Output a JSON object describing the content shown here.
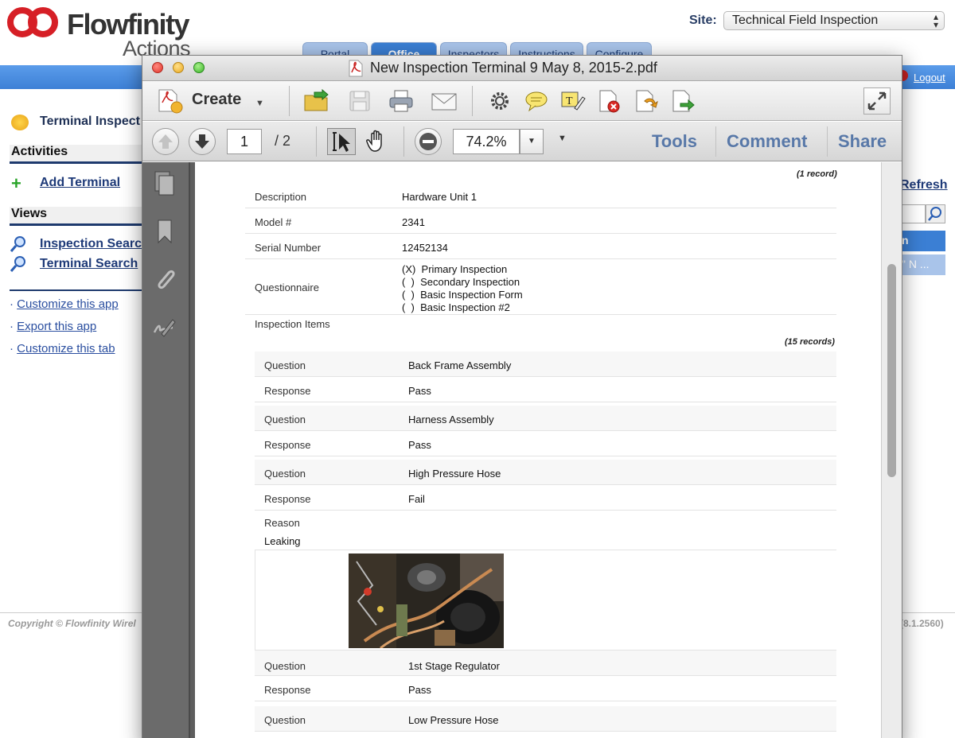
{
  "app": {
    "logo_word": "Flowfinity",
    "logo_sub": "Actions",
    "site_label": "Site:",
    "site_value": "Technical Field Inspection",
    "tabs": [
      {
        "label": "Portal"
      },
      {
        "label": "Office"
      },
      {
        "label": "Inspectors"
      },
      {
        "label": "Instructions"
      },
      {
        "label": "Configure"
      }
    ],
    "logout": "Logout",
    "page_title": "Terminal Inspect",
    "activities_head": "Activities",
    "add_terminal": "Add Terminal",
    "views_head": "Views",
    "inspection_search": "Inspection Searc",
    "terminal_search": "Terminal Search",
    "links": [
      "Customize this app",
      "Export this app",
      "Customize this tab"
    ],
    "copyright": "Copyright © Flowfinity Wirel",
    "version": "(8.1.2560)",
    "refresh": "Refresh",
    "right_blue": "n",
    "right_row": "\" N ..."
  },
  "pdf": {
    "window_title": "New Inspection Terminal 9 May 8, 2015-2.pdf",
    "create_label": "Create",
    "page_current": "1",
    "page_total": "/ 2",
    "zoom": "74.2%",
    "panels": [
      "Tools",
      "Comment",
      "Share"
    ],
    "content": {
      "record_note": "(1 record)",
      "fields": [
        {
          "label": "Description",
          "value": "Hardware Unit 1"
        },
        {
          "label": "Model #",
          "value": "2341"
        },
        {
          "label": "Serial Number",
          "value": "12452134"
        }
      ],
      "questionnaire_label": "Questionnaire",
      "questionnaire_options": [
        "(X)  Primary Inspection",
        "(  )  Secondary Inspection",
        "(  )  Basic Inspection Form",
        "(  )  Basic Inspection #2"
      ],
      "items_label": "Inspection Items",
      "items_note": "(15 records)",
      "items": [
        {
          "label": "Question",
          "value": "Back Frame Assembly"
        },
        {
          "label": "Response",
          "value": "Pass"
        },
        {
          "label": "Question",
          "value": "Harness Assembly"
        },
        {
          "label": "Response",
          "value": "Pass"
        },
        {
          "label": "Question",
          "value": "High Pressure Hose"
        },
        {
          "label": "Response",
          "value": "Fail"
        }
      ],
      "reason_label": "Reason",
      "reason_value": "Leaking",
      "items_after": [
        {
          "label": "Question",
          "value": "1st Stage Regulator"
        },
        {
          "label": "Response",
          "value": "Pass"
        },
        {
          "label": "Question",
          "value": "Low Pressure Hose"
        }
      ]
    }
  }
}
